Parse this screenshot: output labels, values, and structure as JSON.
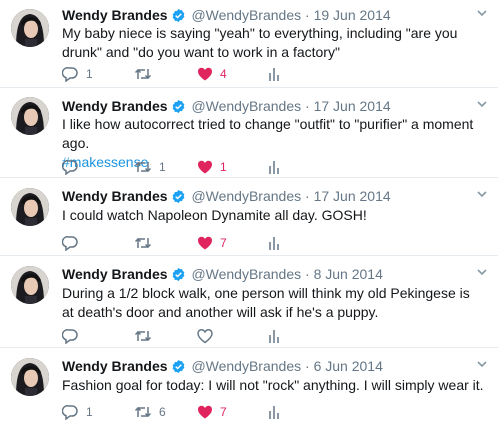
{
  "author": {
    "name": "Wendy Brandes",
    "handle": "@WendyBrandes",
    "separator": "·"
  },
  "colors": {
    "like": "#e0245e",
    "link": "#1b95e0",
    "muted": "#657786",
    "verified": "#1da1f2",
    "divider": "#e6ecf0"
  },
  "icons": [
    "verified-badge-icon",
    "chevron-down-icon",
    "reply-icon",
    "retweet-icon",
    "heart-icon",
    "analytics-icon"
  ],
  "tweets": [
    {
      "date": "19 Jun 2014",
      "text": "My baby niece is saying \"yeah\" to everything, including \"are you drunk\" and \"do you want to work in a factory\"",
      "hashtag": "",
      "replies": "1",
      "retweets": "",
      "likes": "4"
    },
    {
      "date": "17 Jun 2014",
      "text": "I like how autocorrect tried to change \"outfit\" to \"purifier\" a moment ago.",
      "hashtag": "#makessense",
      "replies": "",
      "retweets": "1",
      "likes": "1"
    },
    {
      "date": "17 Jun 2014",
      "text": "I could watch Napoleon Dynamite all day. GOSH!",
      "hashtag": "",
      "replies": "",
      "retweets": "",
      "likes": "7"
    },
    {
      "date": "8 Jun 2014",
      "text": "During a 1/2 block walk, one person will think my old Pekingese is at death's door and another will ask if he's a puppy.",
      "hashtag": "",
      "replies": "",
      "retweets": "",
      "likes": ""
    },
    {
      "date": "6 Jun 2014",
      "text": "Fashion goal for today: I will not \"rock\" anything. I will simply wear it.",
      "hashtag": "",
      "replies": "1",
      "retweets": "6",
      "likes": "7"
    }
  ]
}
